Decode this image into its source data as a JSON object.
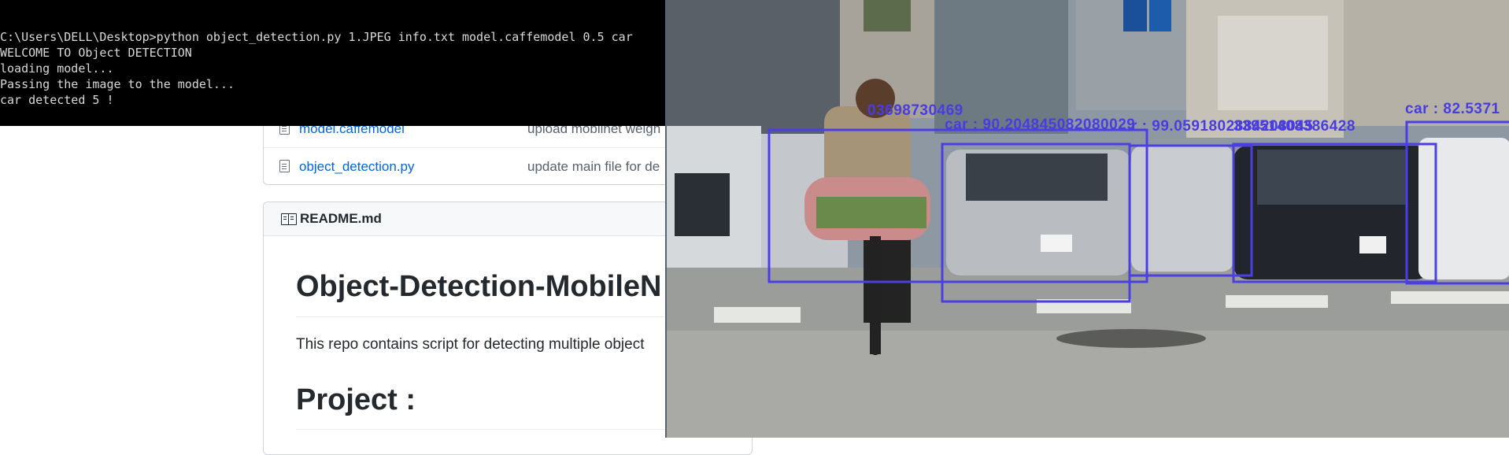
{
  "terminal": {
    "lines": [
      "C:\\Users\\DELL\\Desktop>python object_detection.py 1.JPEG info.txt model.caffemodel 0.5 car",
      "WELCOME TO Object DETECTION",
      "loading model...",
      "Passing the image to the model...",
      "car detected 5 !"
    ]
  },
  "github": {
    "files": [
      {
        "name": "model.caffemodel",
        "message": "upload mobilnet weigh"
      },
      {
        "name": "object_detection.py",
        "message": "update main file for de"
      }
    ],
    "readme": {
      "header": "README.md",
      "title": "Object-Detection-MobileN",
      "paragraph": "This repo contains script for detecting multiple object",
      "subheading": "Project :"
    }
  },
  "image_viewer": {
    "box_color": "#4b3fe3",
    "labels": [
      "03698730469",
      "car : 90.204845082080029",
      "r : 99.0591802884208045",
      "33951408386428",
      "car : 82.5371"
    ]
  },
  "colors": {
    "terminal_bg": "#000000",
    "terminal_text": "#d9d9d9",
    "link": "#0366d6",
    "detection": "#4b3fe3"
  }
}
